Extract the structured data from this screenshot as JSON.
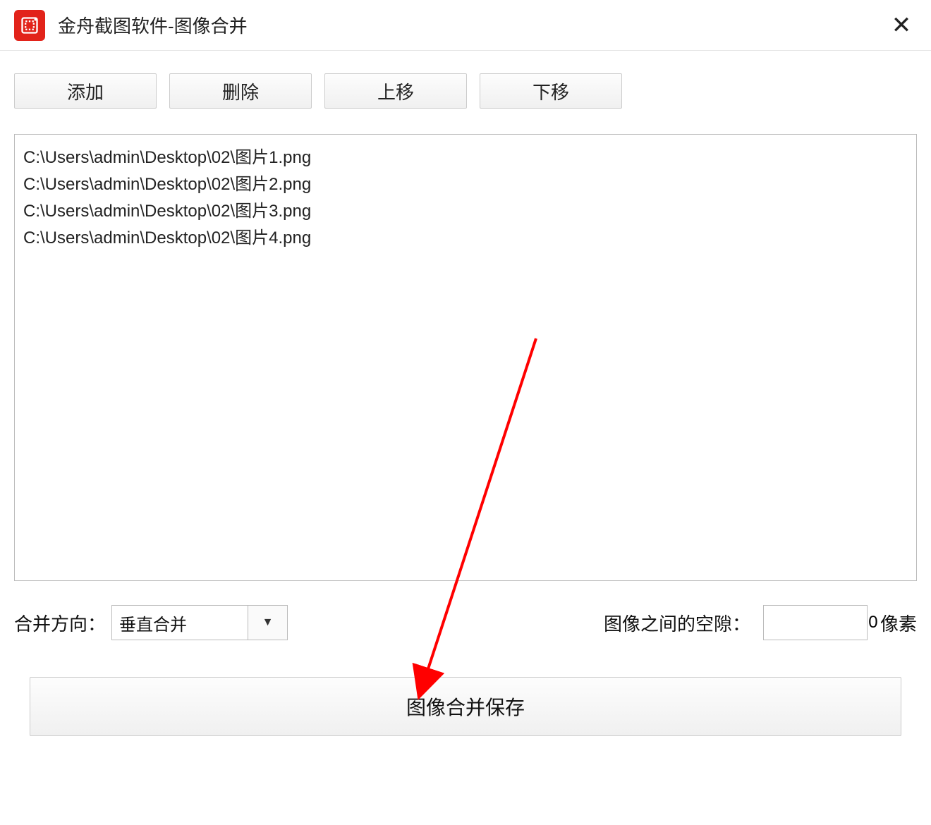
{
  "window": {
    "title": "金舟截图软件-图像合并"
  },
  "toolbar": {
    "add": "添加",
    "delete": "删除",
    "move_up": "上移",
    "move_down": "下移"
  },
  "files": [
    "C:\\Users\\admin\\Desktop\\02\\图片1.png",
    "C:\\Users\\admin\\Desktop\\02\\图片2.png",
    "C:\\Users\\admin\\Desktop\\02\\图片3.png",
    "C:\\Users\\admin\\Desktop\\02\\图片4.png"
  ],
  "options": {
    "direction_label": "合并方向：",
    "direction_value": "垂直合并",
    "gap_label": "图像之间的空隙：",
    "gap_value": "0",
    "unit": "像素"
  },
  "merge_button": "图像合并保存"
}
